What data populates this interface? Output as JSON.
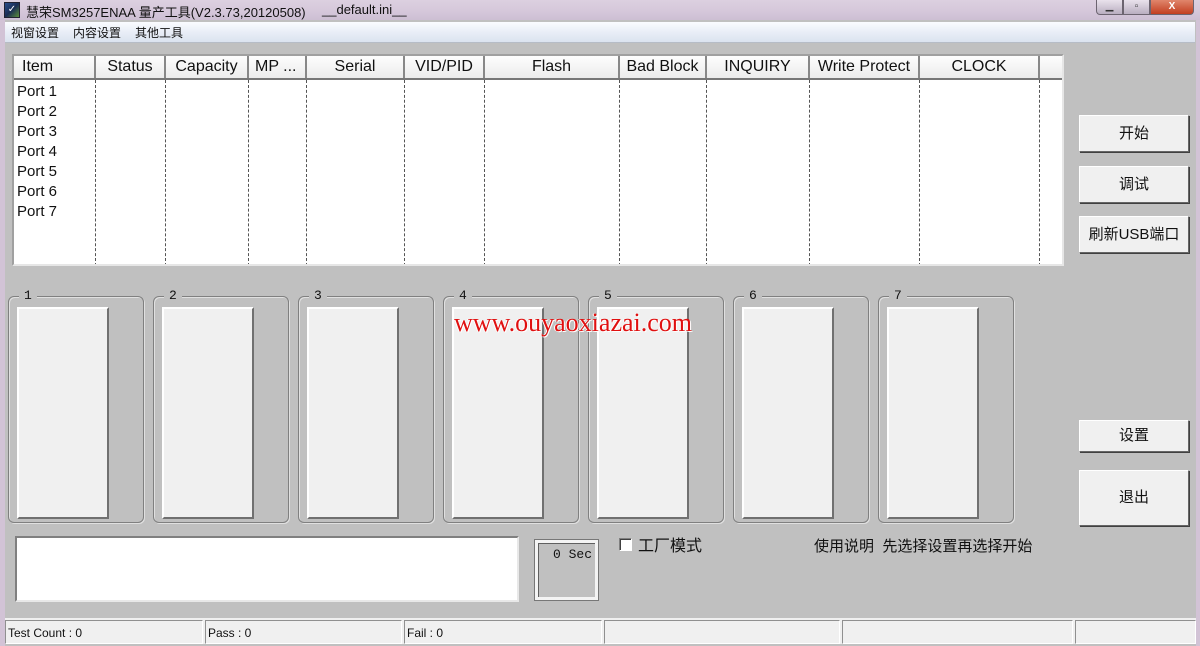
{
  "window": {
    "title": "慧荣SM3257ENAA 量产工具(V2.3.73,20120508)",
    "config_file": "__default.ini__",
    "minimize_glyph": "▁",
    "maximize_glyph": "▫",
    "close_glyph": "X"
  },
  "menu": {
    "items": [
      {
        "label": "视窗设置"
      },
      {
        "label": "内容设置"
      },
      {
        "label": "其他工具"
      }
    ]
  },
  "listview": {
    "columns": [
      {
        "label": "Item"
      },
      {
        "label": "Status"
      },
      {
        "label": "Capacity"
      },
      {
        "label": "MP ..."
      },
      {
        "label": "Serial"
      },
      {
        "label": "VID/PID"
      },
      {
        "label": "Flash"
      },
      {
        "label": "Bad Block"
      },
      {
        "label": "INQUIRY"
      },
      {
        "label": "Write Protect"
      },
      {
        "label": "CLOCK"
      }
    ],
    "rows": [
      {
        "item": "Port 1"
      },
      {
        "item": "Port 2"
      },
      {
        "item": "Port 3"
      },
      {
        "item": "Port 4"
      },
      {
        "item": "Port 5"
      },
      {
        "item": "Port 6"
      },
      {
        "item": "Port 7"
      }
    ]
  },
  "buttons": {
    "start": "开始",
    "debug": "调试",
    "refresh_usb": "刷新USB端口",
    "settings": "设置",
    "exit": "退出"
  },
  "ports": [
    {
      "label": "1"
    },
    {
      "label": "2"
    },
    {
      "label": "3"
    },
    {
      "label": "4"
    },
    {
      "label": "5"
    },
    {
      "label": "6"
    },
    {
      "label": "7"
    }
  ],
  "watermark": "www.ouyaoxiazai.com",
  "timer": {
    "value": "0 Sec"
  },
  "factory_mode": {
    "label": "工厂模式",
    "checked": false
  },
  "instructions": "使用说明  先选择设置再选择开始",
  "statusbar": {
    "test_count": "Test Count : 0",
    "pass": "Pass : 0",
    "fail": "Fail : 0",
    "cell4": "",
    "cell5": "",
    "cell6": ""
  }
}
